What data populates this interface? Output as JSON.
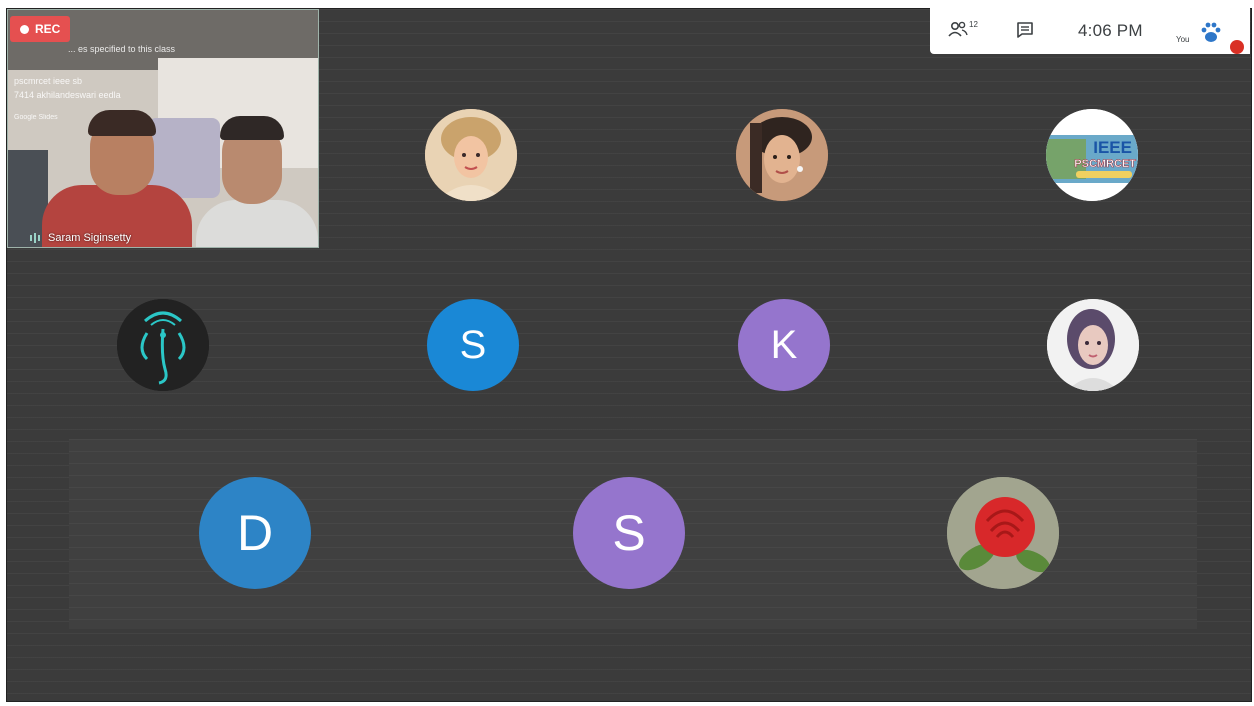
{
  "recording": {
    "label": "REC"
  },
  "self_tile": {
    "name": "Saram Siginsetty",
    "overlay_lines": [
      "... es specified to this class",
      "pscmrcet ieee sb",
      "7414 akhilandeswari eedla",
      "Google Slides"
    ]
  },
  "top_bar": {
    "people_icon": "people-icon",
    "people_count": "12",
    "chat_icon": "chat-icon",
    "time": "4:06 PM",
    "you_label": "You",
    "muted_icon": "mic-off-icon"
  },
  "participants": [
    {
      "type": "photo",
      "icon": "profile-photo-woman"
    },
    {
      "type": "photo",
      "icon": "profile-photo-woman"
    },
    {
      "type": "photo",
      "icon": "ieee-logo",
      "text": [
        "IEEE",
        "PSCMRCET"
      ]
    },
    {
      "type": "photo",
      "icon": "ganesha-art"
    },
    {
      "type": "letter",
      "letter": "S",
      "color": "#1a88d6"
    },
    {
      "type": "letter",
      "letter": "K",
      "color": "#9575cd"
    },
    {
      "type": "photo",
      "icon": "profile-photo-woman"
    },
    {
      "type": "letter",
      "letter": "D",
      "color": "#2d84c6"
    },
    {
      "type": "letter",
      "letter": "S",
      "color": "#9575cd"
    },
    {
      "type": "photo",
      "icon": "rose-flower"
    }
  ]
}
